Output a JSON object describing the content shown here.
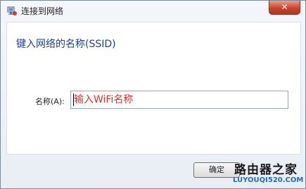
{
  "window": {
    "title": "连接到网络",
    "close_label": "✕"
  },
  "content": {
    "heading": "键入网络的名称(SSID)",
    "name_label": "名称(A):",
    "name_placeholder": "输入WiFi名称"
  },
  "footer": {
    "ok_label": "确定"
  },
  "watermark": {
    "main": "路由器之家",
    "sub": "LUYOUQI520.COM"
  },
  "colors": {
    "heading": "#1e3f8a",
    "input_text": "#e3312a",
    "close_button": "#c9442b",
    "watermark_sub": "#1f6fb5"
  },
  "icons": {
    "title_icon": "network-monitor-icon"
  }
}
